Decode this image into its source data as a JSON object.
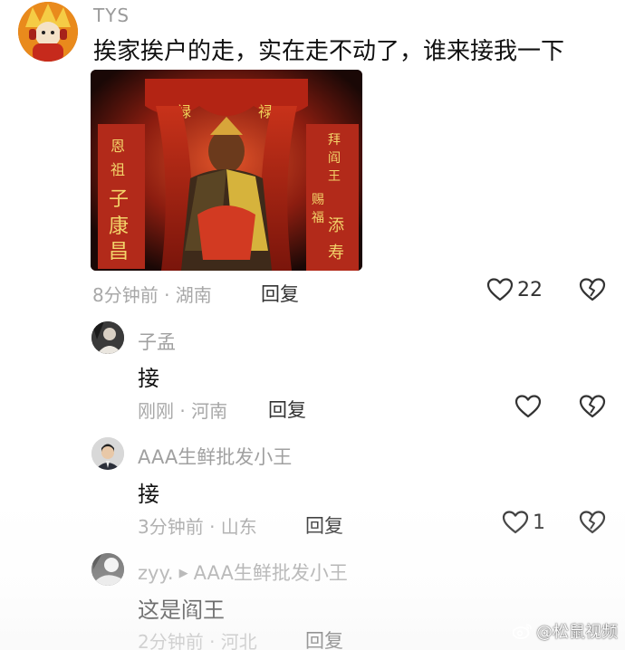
{
  "main_comment": {
    "username": "TYS",
    "text": "挨家挨户的走，实在走不动了，谁来接我一下",
    "time_location": "8分钟前 · 湖南",
    "reply_label": "回复",
    "like_count": "22"
  },
  "replies": [
    {
      "username": "子孟",
      "text": "接",
      "time_location": "刚刚 · 河南",
      "reply_label": "回复",
      "like_count": ""
    },
    {
      "username": "AAA生鲜批发小王",
      "text": "接",
      "time_location": "3分钟前 · 山东",
      "reply_label": "回复",
      "like_count": "1"
    },
    {
      "username": "zyy.",
      "reply_to": "AAA生鲜批发小王",
      "text": "这是阎王",
      "time_location": "2分钟前 · 河北",
      "reply_label": "回复"
    }
  ],
  "photo": {
    "banner_left": "恩祖子康昌",
    "banner_right": "拜阎王赐福添寿"
  },
  "watermark": {
    "text": "@松鼠视频"
  },
  "icons": {
    "like": "heart-icon",
    "dislike": "broken-heart-icon",
    "reply_arrow": "triangle-right-icon",
    "platform": "weibo-icon"
  },
  "colors": {
    "meta_gray": "#a8a8a8",
    "username_gray": "#9a9a9a",
    "text": "#111111"
  }
}
